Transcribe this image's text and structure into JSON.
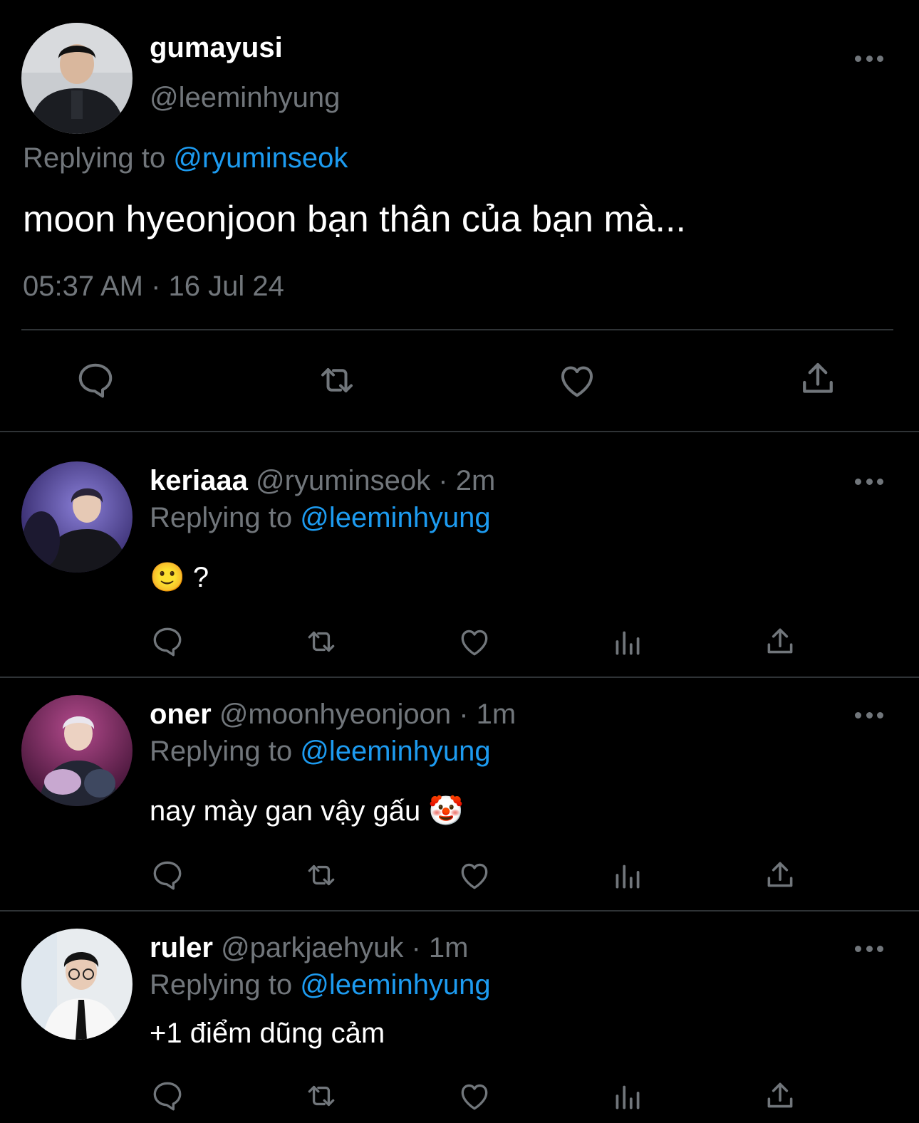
{
  "main_tweet": {
    "display_name": "gumayusi",
    "handle": "@leeminhyung",
    "replying_prefix": "Replying to",
    "replying_to": "@ryuminseok",
    "text": "moon hyeonjoon bạn thân của bạn mà...",
    "timestamp": "05:37 AM · 16 Jul 24",
    "actions": [
      "reply-icon",
      "retweet-icon",
      "like-icon",
      "share-icon"
    ]
  },
  "replies": [
    {
      "display_name": "keriaaa",
      "handle": "@ryuminseok",
      "time": "· 2m",
      "replying_prefix": "Replying to",
      "replying_to": "@leeminhyung",
      "text": "🙂 ?",
      "actions": [
        "reply-icon",
        "retweet-icon",
        "like-icon",
        "views-icon",
        "share-icon"
      ]
    },
    {
      "display_name": "oner",
      "handle": "@moonhyeonjoon",
      "time": "· 1m",
      "replying_prefix": "Replying to",
      "replying_to": "@leeminhyung",
      "text": "nay mày gan vậy gấu 🤡",
      "actions": [
        "reply-icon",
        "retweet-icon",
        "like-icon",
        "views-icon",
        "share-icon"
      ]
    },
    {
      "display_name": "ruler",
      "handle": "@parkjaehyuk",
      "time": "· 1m",
      "replying_prefix": "Replying to",
      "replying_to": "@leeminhyung",
      "text": "+1 điểm dũng cảm",
      "actions": [
        "reply-icon",
        "retweet-icon",
        "like-icon",
        "views-icon",
        "share-icon"
      ]
    }
  ],
  "colors": {
    "background": "#000000",
    "text": "#e7e9ea",
    "muted": "#71767b",
    "link": "#1d9bf0",
    "divider": "#2f3336"
  }
}
